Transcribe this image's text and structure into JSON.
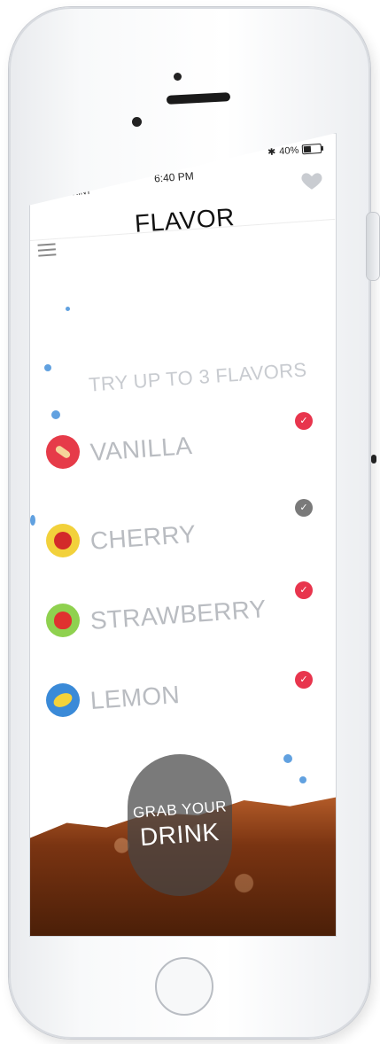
{
  "status_bar": {
    "carrier": "●●○○○ SPRINT",
    "time": "6:40 PM",
    "battery": "40%"
  },
  "header": {
    "title": "FLAVOR"
  },
  "prompt": "TRY UP TO 3 FLAVORS",
  "flavors": [
    {
      "label": "VANILLA",
      "icon": "vanilla-icon",
      "selected": true
    },
    {
      "label": "CHERRY",
      "icon": "cherry-icon",
      "selected": false
    },
    {
      "label": "STRAWBERRY",
      "icon": "strawberry-icon",
      "selected": true
    },
    {
      "label": "LEMON",
      "icon": "lemon-icon",
      "selected": true
    }
  ],
  "cta": {
    "line1": "GRAB YOUR",
    "line2": "DRINK"
  },
  "colors": {
    "selected": "#e8354d",
    "unselected": "#7a7a7a",
    "vanilla_bg": "#e63b49",
    "cherry_bg": "#f2d13b",
    "strawberry_bg": "#8fd14f",
    "lemon_bg": "#3a8ad8"
  }
}
